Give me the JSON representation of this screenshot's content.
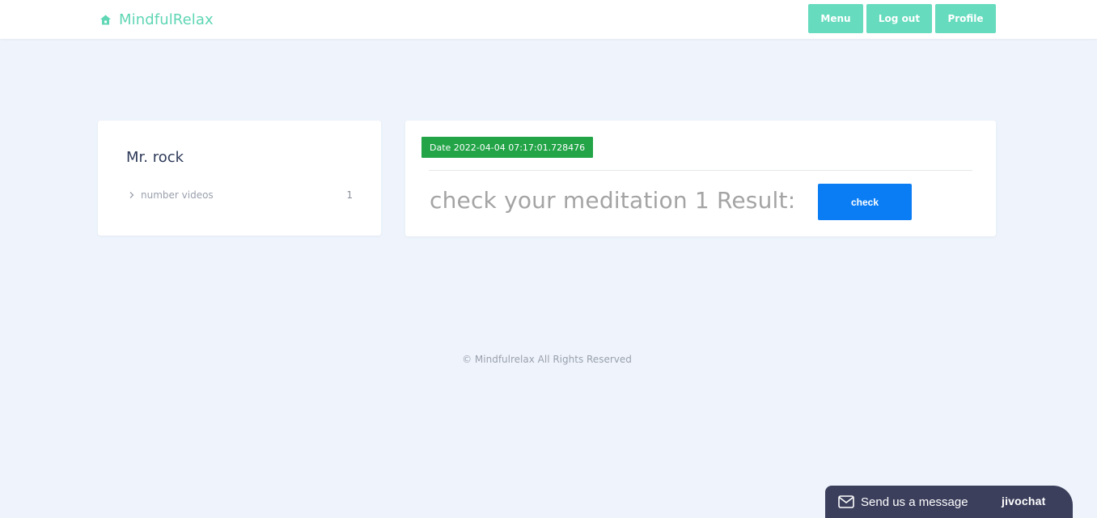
{
  "header": {
    "brand": "MindfulRelax",
    "brand_icon": "home-icon",
    "nav": {
      "menu": "Menu",
      "logout": "Log out",
      "profile": "Profile"
    }
  },
  "profile": {
    "name": "Mr. rock",
    "stats": [
      {
        "label": "number videos",
        "value": "1"
      }
    ]
  },
  "result": {
    "date_badge": "Date 2022-04-04 07:17:01.728476",
    "text": "check your meditation 1 Result:",
    "check_label": "check"
  },
  "footer": {
    "text": "© Mindfulrelax All Rights Reserved"
  },
  "chat": {
    "label": "Send us a message",
    "brand": "jivochat"
  },
  "colors": {
    "accent": "#66dbbe",
    "brand": "#5fd6b4",
    "badge": "#22a447",
    "primary": "#0a7df5",
    "background": "#eff4fc",
    "chat": "#3b3f5c"
  }
}
